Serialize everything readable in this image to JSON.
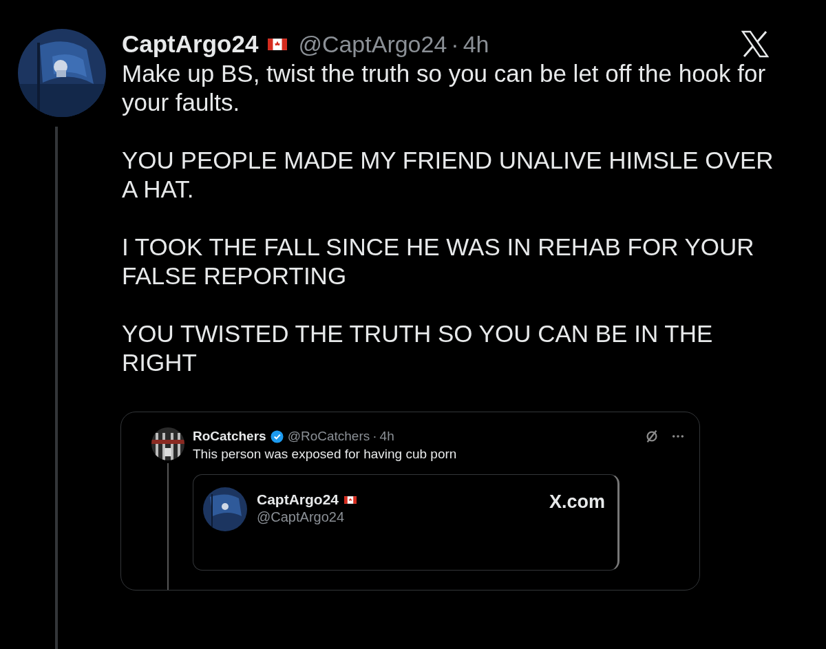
{
  "post": {
    "name": "CaptArgo24",
    "handle": "@CaptArgo24",
    "separator": "·",
    "time": "4h",
    "paragraphs": [
      "Make up BS, twist the truth so you can be let off the hook for your faults.",
      "YOU PEOPLE MADE MY FRIEND UNALIVE HIMSLE OVER A HAT.",
      "I TOOK THE FALL SINCE HE WAS IN REHAB FOR YOUR FALSE REPORTING",
      "YOU TWISTED THE TRUTH SO YOU CAN BE IN THE RIGHT"
    ]
  },
  "quote": {
    "name": "RoCatchers",
    "verified": true,
    "handle": "@RoCatchers",
    "separator": "·",
    "time": "4h",
    "text": "This person was exposed for having cub porn",
    "card": {
      "name": "CaptArgo24",
      "handle": "@CaptArgo24",
      "site": "X.com"
    }
  }
}
